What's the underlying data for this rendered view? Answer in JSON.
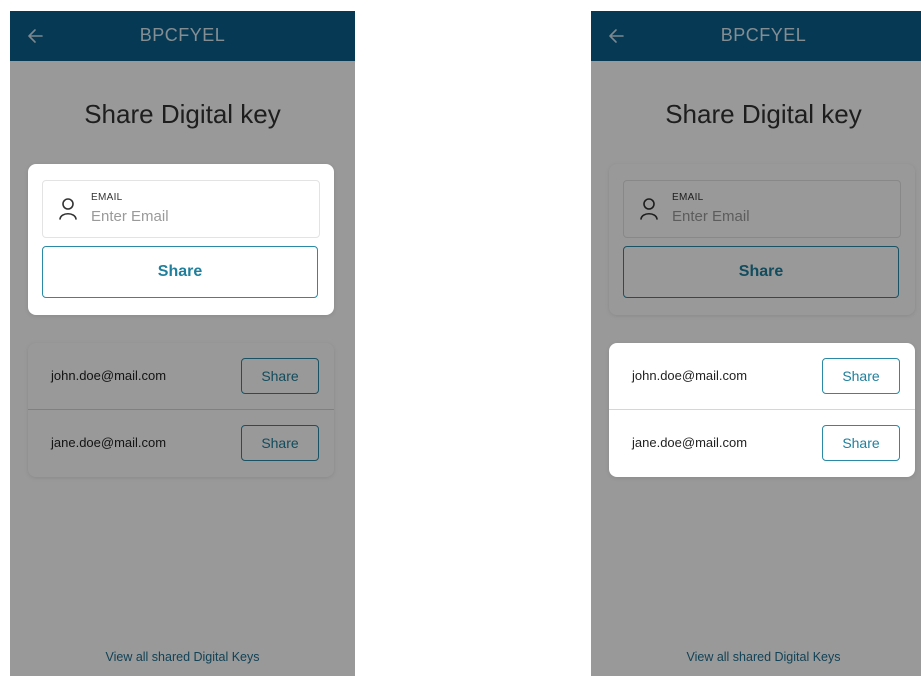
{
  "screens": [
    {
      "highlight": "email-card",
      "appbar": {
        "title": "BPCFYEL",
        "back_icon": "arrow-left-icon"
      },
      "title": "Share Digital key",
      "email_form": {
        "label": "EMAIL",
        "placeholder": "Enter Email",
        "value": "",
        "icon": "user-icon",
        "share_label": "Share"
      },
      "contacts": [
        {
          "email": "john.doe@mail.com",
          "share_label": "Share"
        },
        {
          "email": "jane.doe@mail.com",
          "share_label": "Share"
        }
      ],
      "footer_link": "View all shared Digital Keys"
    },
    {
      "highlight": "list-card",
      "appbar": {
        "title": "BPCFYEL",
        "back_icon": "arrow-left-icon"
      },
      "title": "Share Digital key",
      "email_form": {
        "label": "EMAIL",
        "placeholder": "Enter Email",
        "value": "",
        "icon": "user-icon",
        "share_label": "Share"
      },
      "contacts": [
        {
          "email": "john.doe@mail.com",
          "share_label": "Share"
        },
        {
          "email": "jane.doe@mail.com",
          "share_label": "Share"
        }
      ],
      "footer_link": "View all shared Digital Keys"
    }
  ],
  "colors": {
    "appbar": "#0a5f8c",
    "accent": "#2a8aa6",
    "overlay": "rgba(0,0,0,0.40)"
  }
}
